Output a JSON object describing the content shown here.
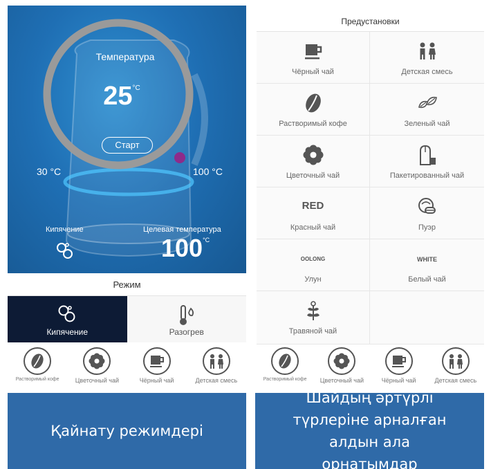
{
  "left": {
    "temperature_label": "Температура",
    "temperature_value": "25",
    "temperature_unit": "°C",
    "start_button": "Старт",
    "range_min": "30 °C",
    "range_max": "100 °C",
    "boil_label": "Кипячение",
    "target_label": "Целевая температура",
    "target_value": "100",
    "target_unit": "°C",
    "mode_title": "Режим",
    "modes": [
      {
        "label": "Кипячение",
        "icon": "bubbles-icon",
        "active": true
      },
      {
        "label": "Разогрев",
        "icon": "thermometer-flame-icon",
        "active": false
      }
    ],
    "quick": [
      {
        "label": "Растворимый кофе",
        "icon": "coffee-bean-icon"
      },
      {
        "label": "Цветочный чай",
        "icon": "flower-icon"
      },
      {
        "label": "Чёрный чай",
        "icon": "cup-icon"
      },
      {
        "label": "Детская смесь",
        "icon": "children-icon"
      }
    ],
    "colors": {
      "accent": "#8e2b8a",
      "active_tab": "#0d1b35",
      "hero": "#1f6fb4"
    }
  },
  "right": {
    "title": "Предустановки",
    "presets": [
      {
        "label": "Чёрный чай",
        "icon": "cup-icon"
      },
      {
        "label": "Детская смесь",
        "icon": "children-icon"
      },
      {
        "label": "Растворимый кофе",
        "icon": "coffee-bean-icon"
      },
      {
        "label": "Зеленый чай",
        "icon": "leaves-icon"
      },
      {
        "label": "Цветочный чай",
        "icon": "flower-icon"
      },
      {
        "label": "Пакетированный чай",
        "icon": "teabag-icon"
      },
      {
        "label": "Красный чай",
        "icon_text": "RED"
      },
      {
        "label": "Пуэр",
        "icon": "puer-icon"
      },
      {
        "label": "Улун",
        "icon_text": "OOLONG"
      },
      {
        "label": "Белый чай",
        "icon_text": "WHITE"
      },
      {
        "label": "Травяной чай",
        "icon": "herb-icon"
      }
    ],
    "quick": [
      {
        "label": "Растворимый кофе",
        "icon": "coffee-bean-icon"
      },
      {
        "label": "Цветочный чай",
        "icon": "flower-icon"
      },
      {
        "label": "Чёрный чай",
        "icon": "cup-icon"
      },
      {
        "label": "Детская смесь",
        "icon": "children-icon"
      }
    ]
  },
  "captions": {
    "left": "Қайнату режимдері",
    "right": "Шайдың әртүрлі түрлеріне арналған алдын ала орнатымдар"
  }
}
